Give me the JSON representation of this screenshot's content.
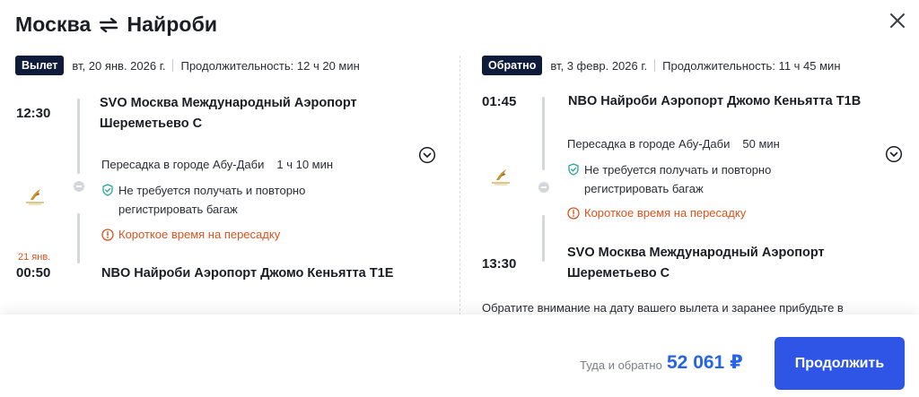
{
  "header": {
    "origin": "Москва",
    "destination": "Найроби"
  },
  "outbound": {
    "badge": "Вылет",
    "date": "вт, 20 янв. 2026 г.",
    "duration": "Продолжительность: 12 ч 20 мин",
    "depart_time": "12:30",
    "depart_station": "SVO Москва Международный Аэропорт Шереметьево C",
    "transfer_city": "Пересадка в городе Абу-Даби",
    "transfer_duration": "1 ч 10 мин",
    "baggage_note": "Не требуется получать и повторно регистрировать багаж",
    "short_transfer_warning": "Короткое время на пересадку",
    "arrival_nextday": "21 янв.",
    "arrive_time": "00:50",
    "arrive_station": "NBO Найроби Аэропорт Джомо Кеньятта T1E"
  },
  "return": {
    "badge": "Обратно",
    "date": "вт, 3 февр. 2026 г.",
    "duration": "Продолжительность: 11 ч 45 мин",
    "depart_time": "01:45",
    "depart_station": "NBO Найроби Аэропорт Джомо Кеньятта T1B",
    "transfer_city": "Пересадка в городе Абу-Даби",
    "transfer_duration": "50 мин",
    "baggage_note": "Не требуется получать и повторно регистрировать багаж",
    "short_transfer_warning": "Короткое время на пересадку",
    "arrive_time": "13:30",
    "arrive_station": "SVO Москва Международный Аэропорт Шереметьево C",
    "info": "Обратите внимание на дату вашего вылета и заранее прибудьте в"
  },
  "footer": {
    "price_label": "Туда и обратно",
    "price": "52 061 ₽",
    "continue_label": "Продолжить"
  },
  "colors": {
    "accent": "#2f55e6",
    "price": "#2563eb",
    "warning": "#d9531e",
    "badge_bg": "#0f1b3a",
    "shield": "#2aa39a"
  },
  "icons": [
    "swap-arrows-icon",
    "close-icon",
    "airline-logo-icon",
    "transfer-dot-icon",
    "shield-check-icon",
    "warning-circle-icon",
    "chevron-down-circle-icon"
  ]
}
